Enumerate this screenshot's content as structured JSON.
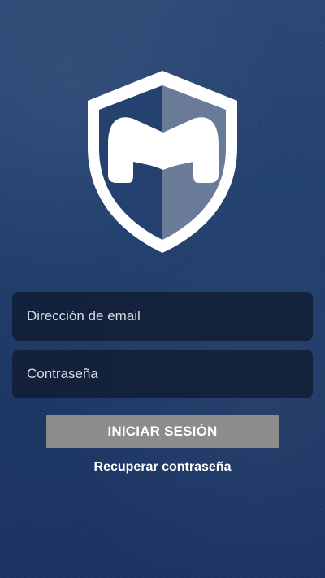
{
  "login": {
    "email_placeholder": "Dirección de email",
    "email_value": "",
    "password_placeholder": "Contraseña",
    "password_value": "",
    "submit_label": "INICIAR SESIÓN",
    "recover_label": "Recuperar contraseña"
  },
  "logo": {
    "icon": "shield-m-logo",
    "color": "#ffffff"
  },
  "colors": {
    "background_top": "#2c4775",
    "background_bottom": "#1a3362",
    "button": "#8c8c8c",
    "field": "#0e182a"
  }
}
